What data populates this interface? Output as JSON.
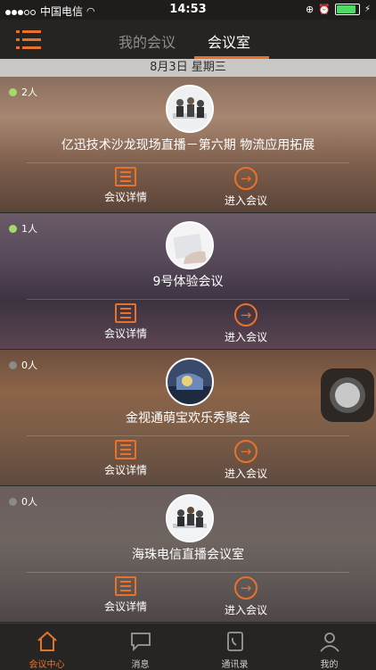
{
  "status": {
    "carrier": "中国电信",
    "time": "14:53"
  },
  "nav": {
    "tabs": [
      "我的会议",
      "会议室"
    ],
    "active_tab": "会议室"
  },
  "date_label": "8月3日 星期三",
  "meetings": [
    {
      "count": "2人",
      "status_color": "#a7d86a",
      "title": "亿迅技术沙龙现场直播－第六期 物流应用拓展",
      "detail_label": "会议详情",
      "enter_label": "进入会议"
    },
    {
      "count": "1人",
      "status_color": "#a7d86a",
      "title": "9号体验会议",
      "detail_label": "会议详情",
      "enter_label": "进入会议"
    },
    {
      "count": "0人",
      "status_color": "#8a8a8a",
      "title": "金视通萌宝欢乐秀聚会",
      "detail_label": "会议详情",
      "enter_label": "进入会议"
    },
    {
      "count": "0人",
      "status_color": "#8a8a8a",
      "title": "海珠电信直播会议室",
      "detail_label": "会议详情",
      "enter_label": "进入会议"
    }
  ],
  "tabbar": {
    "items": [
      "会议中心",
      "消息",
      "通讯录",
      "我的"
    ],
    "active": "会议中心",
    "active_color": "#e8722a"
  },
  "colors": {
    "accent": "#e8722a"
  }
}
